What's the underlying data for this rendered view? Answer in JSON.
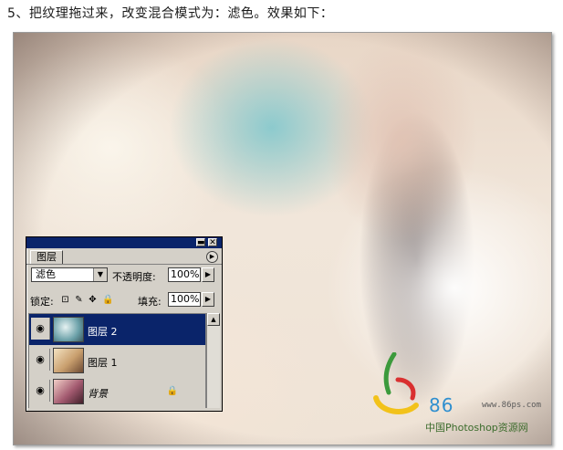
{
  "caption": "5、把纹理拖过来，改变混合模式为：滤色。效果如下：",
  "watermark": {
    "number": "86",
    "url": "www.86ps.com",
    "site": "中国Photoshop资源网"
  },
  "layers_panel": {
    "tab": "图层",
    "blend_mode": "滤色",
    "opacity_label": "不透明度:",
    "opacity_value": "100%",
    "lock_label": "锁定:",
    "fill_label": "填充:",
    "fill_value": "100%",
    "layers": [
      {
        "name": "图层 2",
        "selected": true,
        "visible": true
      },
      {
        "name": "图层 1",
        "selected": false,
        "visible": true
      },
      {
        "name": "背景",
        "selected": false,
        "visible": true,
        "locked": true
      }
    ]
  },
  "icons": {
    "eye": "eye-icon",
    "lock": "lock-icon",
    "move": "move-icon",
    "brush": "brush-icon",
    "transparency": "lock-transparency-icon"
  },
  "colors": {
    "titlebar": "#0a246a",
    "selection": "#0a246a",
    "panel": "#d4d0c8",
    "watermark_blue": "#2f8fcf"
  }
}
